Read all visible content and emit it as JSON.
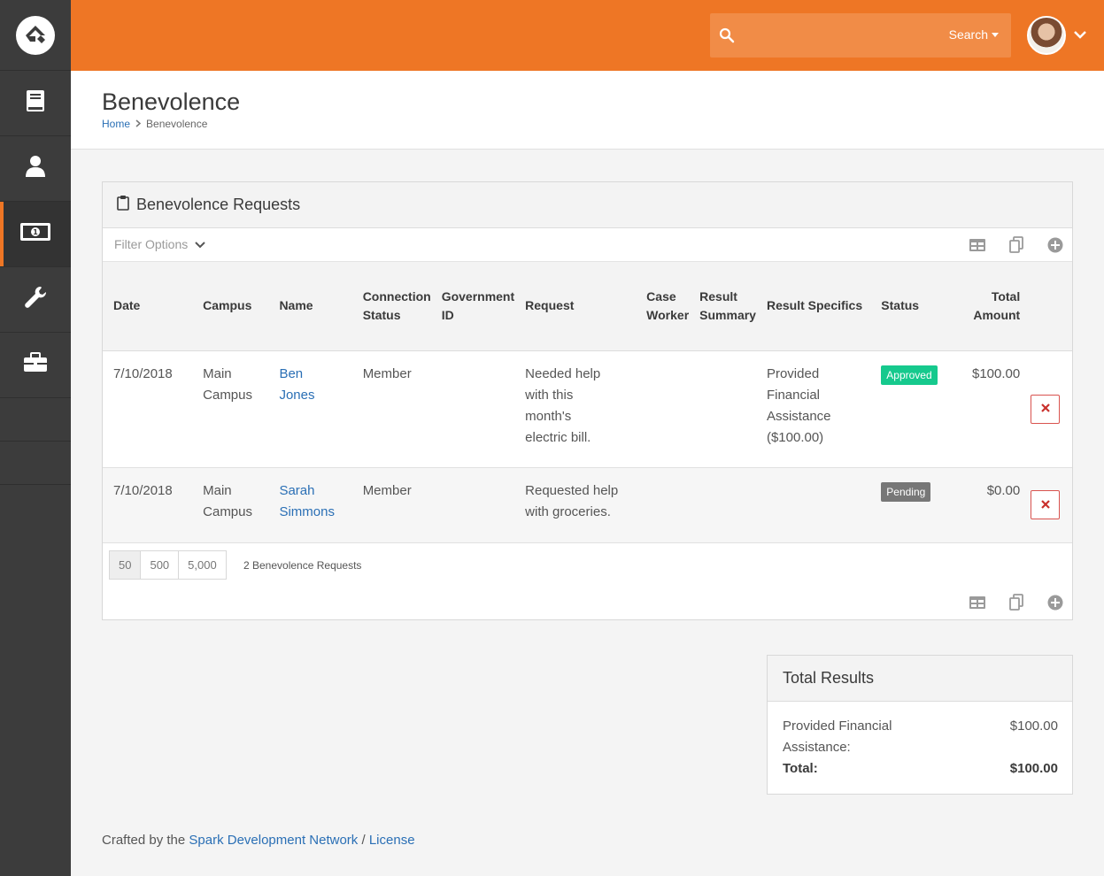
{
  "header": {
    "search_placeholder": "",
    "search_button": "Search"
  },
  "page": {
    "title": "Benevolence",
    "breadcrumb": [
      "Home",
      "Benevolence"
    ]
  },
  "panel": {
    "title": "Benevolence Requests",
    "filter_options": "Filter Options",
    "columns": {
      "date": "Date",
      "campus": "Campus",
      "name": "Name",
      "connection_status_1": "Connection",
      "connection_status_2": "Status",
      "government_id_1": "Government",
      "government_id_2": "ID",
      "request": "Request",
      "case_worker_1": "Case",
      "case_worker_2": "Worker",
      "result_summary_1": "Result",
      "result_summary_2": "Summary",
      "result_specifics": "Result Specifics",
      "status": "Status",
      "total_amount_1": "Total",
      "total_amount_2": "Amount"
    },
    "rows": [
      {
        "date": "7/10/2018",
        "campus_1": "Main",
        "campus_2": "Campus",
        "name_1": "Ben",
        "name_2": "Jones",
        "connection_status": "Member",
        "government_id": "",
        "request": [
          "Needed help",
          "with this",
          "month's",
          "electric bill."
        ],
        "case_worker": "",
        "result_summary": "",
        "result_specifics": [
          "Provided",
          "Financial",
          "Assistance",
          "($100.00)"
        ],
        "status": "Approved",
        "total_amount": "$100.00"
      },
      {
        "date": "7/10/2018",
        "campus_1": "Main",
        "campus_2": "Campus",
        "name_1": "Sarah",
        "name_2": "Simmons",
        "connection_status": "Member",
        "government_id": "",
        "request": [
          "Requested help",
          "with groceries."
        ],
        "case_worker": "",
        "result_summary": "",
        "result_specifics": [],
        "status": "Pending",
        "total_amount": "$0.00"
      }
    ],
    "page_sizes": [
      "50",
      "500",
      "5,000"
    ],
    "count_label": "2 Benevolence Requests"
  },
  "total_results": {
    "title": "Total Results",
    "items": [
      {
        "label_1": "Provided Financial",
        "label_2": "Assistance:",
        "value": "$100.00"
      }
    ],
    "total_label": "Total:",
    "total_value": "$100.00"
  },
  "footer": {
    "prefix": "Crafted by the",
    "link": "Spark Development Network",
    "sep": "/",
    "license": "License"
  },
  "colors": {
    "brand_orange": "#ee7625",
    "sidebar": "#3c3c3c",
    "approved": "#16c98d",
    "pending": "#777777",
    "link": "#2a6fb5",
    "delete": "#d9534f"
  },
  "icons": [
    "rock-logo-icon",
    "book-icon",
    "person-icon",
    "money-icon",
    "wrench-icon",
    "briefcase-icon",
    "search-icon",
    "clipboard-icon",
    "chevron-down-icon",
    "excel-icon",
    "merge-icon",
    "add-icon",
    "close-icon"
  ]
}
